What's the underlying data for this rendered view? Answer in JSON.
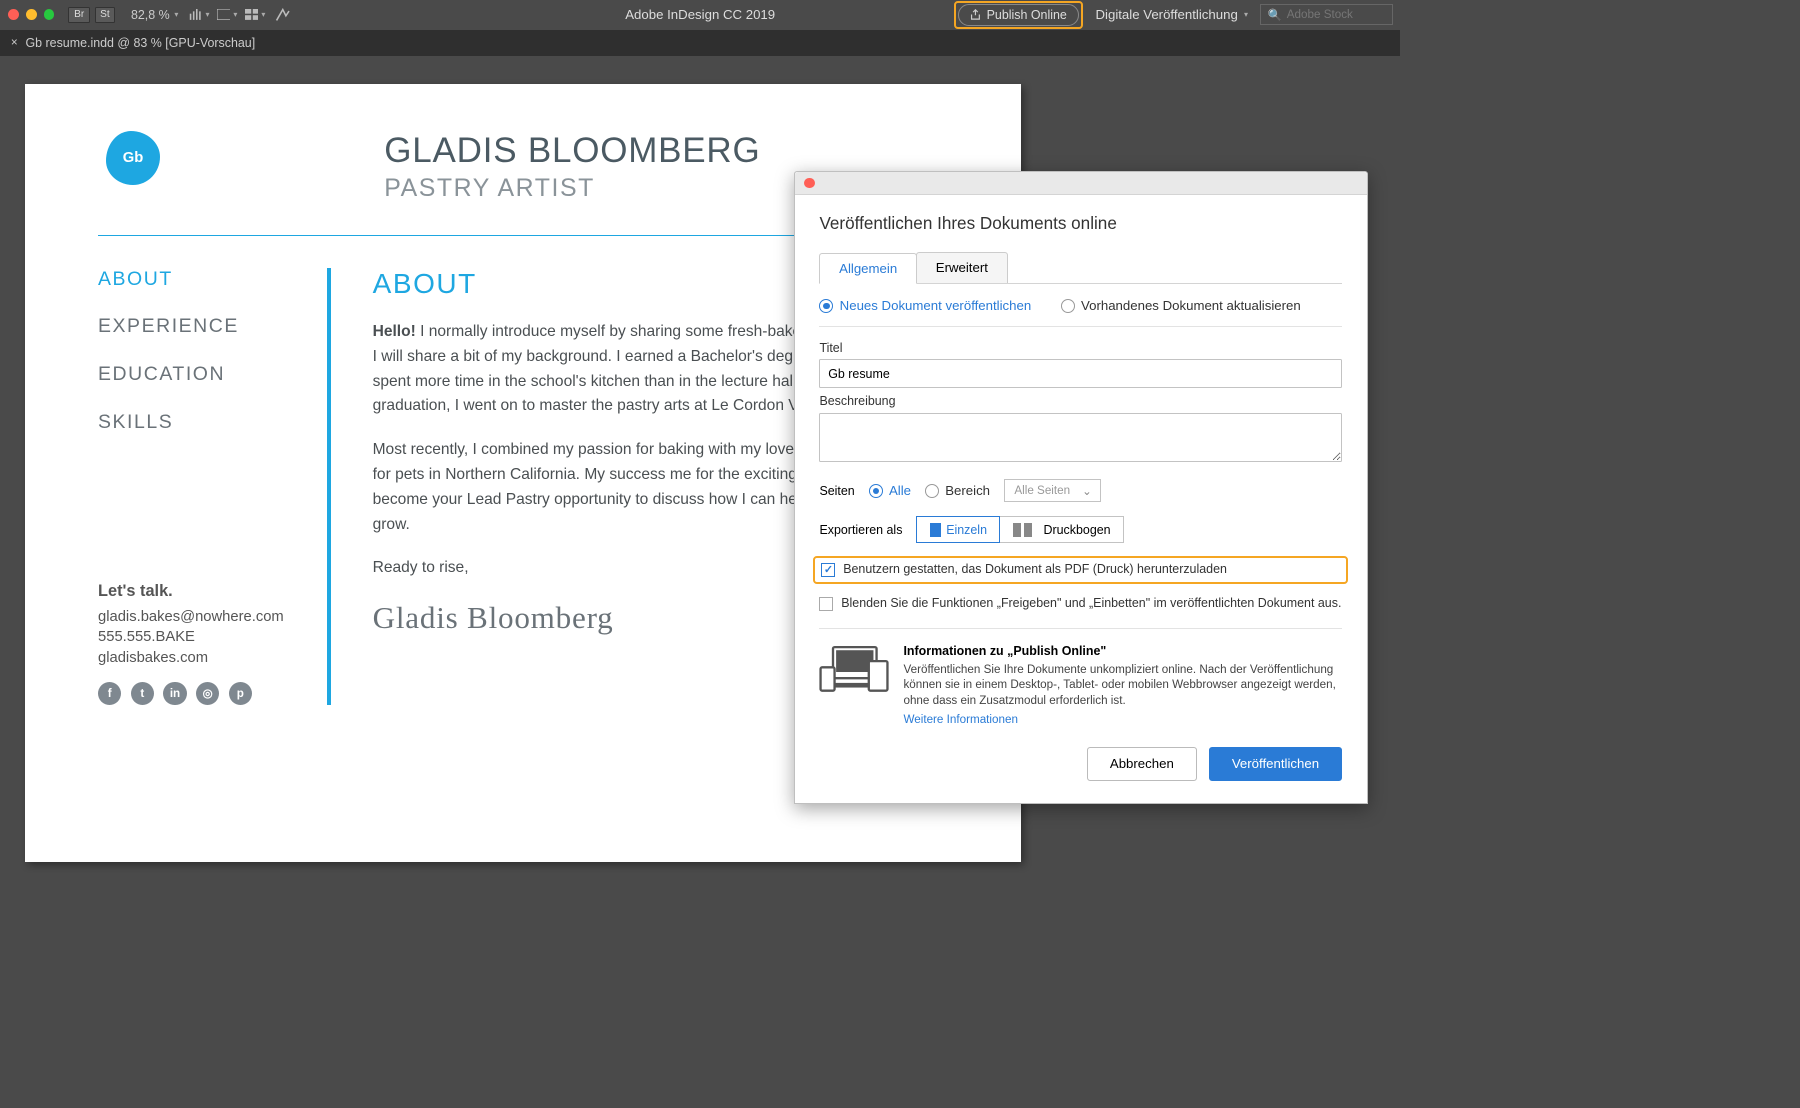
{
  "appbar": {
    "br": "Br",
    "st": "St",
    "zoom": "82,8 %",
    "title": "Adobe InDesign CC 2019",
    "publish": "Publish Online",
    "workspace": "Digitale Veröffentlichung",
    "stock_placeholder": "Adobe Stock"
  },
  "tab": {
    "label": "Gb resume.indd @ 83 % [GPU-Vorschau]"
  },
  "resume": {
    "logo": "Gb",
    "name": "GLADIS BLOOMBERG",
    "subtitle": "PASTRY ARTIST",
    "side": {
      "about": "ABOUT",
      "experience": "EXPERIENCE",
      "education": "EDUCATION",
      "skills": "SKILLS"
    },
    "contact": {
      "hdr": "Let's talk.",
      "email": "gladis.bakes@nowhere.com",
      "phone": "555.555.BAKE",
      "site": "gladisbakes.com"
    },
    "main": {
      "heading": "ABOUT",
      "hello": "Hello!",
      "p1": " I normally introduce myself by sharing some fresh-baked bread, but for now I will share a bit of my background. I earned a Bachelor's degree in business, but spent more time in the school's kitchen than in the lecture halls. So after graduation, I went on to master the pastry arts at Le Cordon Vert.",
      "p2": "Most recently, I combined my passion for baking with my love of the first bakeries for pets in Northern California. My success me for the exciting opportunity to become your Lead Pastry opportunity to discuss how I can help your business grow.",
      "p3": "Ready to rise,",
      "sig": "Gladis Bloomberg"
    }
  },
  "dialog": {
    "heading": "Veröffentlichen Ihres Dokuments online",
    "tab_general": "Allgemein",
    "tab_advanced": "Erweitert",
    "radio_new": "Neues Dokument veröffentlichen",
    "radio_update": "Vorhandenes Dokument aktualisieren",
    "lbl_title": "Titel",
    "val_title": "Gb resume",
    "lbl_desc": "Beschreibung",
    "lbl_pages": "Seiten",
    "radio_all": "Alle",
    "radio_range": "Bereich",
    "dd_allpages": "Alle Seiten",
    "lbl_export": "Exportieren als",
    "seg_single": "Einzeln",
    "seg_spread": "Druckbogen",
    "cb_pdf": "Benutzern gestatten, das Dokument als PDF (Druck) herunterzuladen",
    "cb_hide": "Blenden Sie die Funktionen „Freigeben\" und „Einbetten\" im veröffentlichten Dokument aus.",
    "info_h": "Informationen zu „Publish Online\"",
    "info_p": "Veröffentlichen Sie Ihre Dokumente unkompliziert online. Nach der Veröffentlichung können sie in einem Desktop-, Tablet- oder mobilen Webbrowser angezeigt werden, ohne dass ein Zusatzmodul erforderlich ist.",
    "info_link": "Weitere Informationen",
    "btn_cancel": "Abbrechen",
    "btn_publish": "Veröffentlichen"
  }
}
